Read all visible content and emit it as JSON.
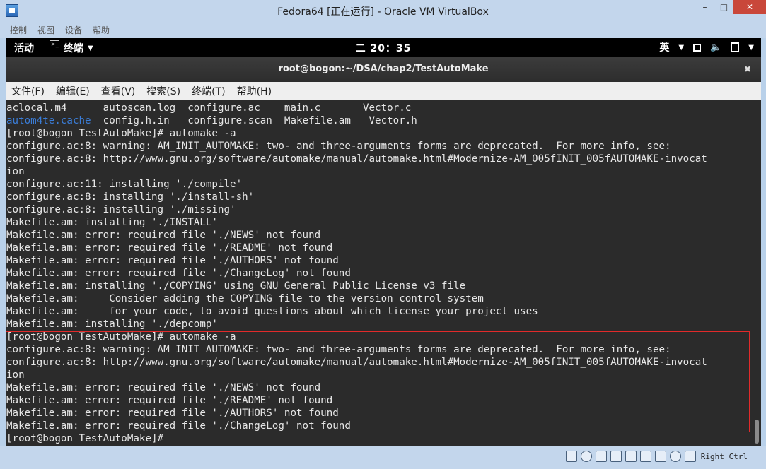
{
  "window": {
    "title": "Fedora64 [正在运行] - Oracle VM VirtualBox",
    "minimize": "–",
    "maximize": "□",
    "close": "✕"
  },
  "vbox_menu": [
    "控制",
    "视图",
    "设备",
    "帮助"
  ],
  "topbar": {
    "activities": "活动",
    "app_label": "终端",
    "clock": "二 20：35",
    "ime": "英"
  },
  "terminal": {
    "title": "root@bogon:~/DSA/chap2/TestAutoMake",
    "menu": [
      "文件(F)",
      "编辑(E)",
      "查看(V)",
      "搜索(S)",
      "终端(T)",
      "帮助(H)"
    ],
    "lines": [
      "aclocal.m4      autoscan.log  configure.ac    main.c       Vector.c",
      "  config.h.in   configure.scan  Makefile.am   Vector.h",
      "[root@bogon TestAutoMake]# automake -a",
      "configure.ac:8: warning: AM_INIT_AUTOMAKE: two- and three-arguments forms are deprecated.  For more info, see:",
      "configure.ac:8: http://www.gnu.org/software/automake/manual/automake.html#Modernize-AM_005fINIT_005fAUTOMAKE-invocat",
      "ion",
      "configure.ac:11: installing './compile'",
      "configure.ac:8: installing './install-sh'",
      "configure.ac:8: installing './missing'",
      "Makefile.am: installing './INSTALL'",
      "Makefile.am: error: required file './NEWS' not found",
      "Makefile.am: error: required file './README' not found",
      "Makefile.am: error: required file './AUTHORS' not found",
      "Makefile.am: error: required file './ChangeLog' not found",
      "Makefile.am: installing './COPYING' using GNU General Public License v3 file",
      "Makefile.am:     Consider adding the COPYING file to the version control system",
      "Makefile.am:     for your code, to avoid questions about which license your project uses",
      "Makefile.am: installing './depcomp'",
      "[root@bogon TestAutoMake]# automake -a",
      "configure.ac:8: warning: AM_INIT_AUTOMAKE: two- and three-arguments forms are deprecated.  For more info, see:",
      "configure.ac:8: http://www.gnu.org/software/automake/manual/automake.html#Modernize-AM_005fINIT_005fAUTOMAKE-invocat",
      "ion",
      "Makefile.am: error: required file './NEWS' not found",
      "Makefile.am: error: required file './README' not found",
      "Makefile.am: error: required file './AUTHORS' not found",
      "Makefile.am: error: required file './ChangeLog' not found",
      "[root@bogon TestAutoMake]#"
    ],
    "blue_dir": "autom4te.cache",
    "blue_color": "#3a7cd6",
    "highlight_color": "#e12a2a"
  },
  "statusbar": {
    "host_key": "Right Ctrl"
  }
}
